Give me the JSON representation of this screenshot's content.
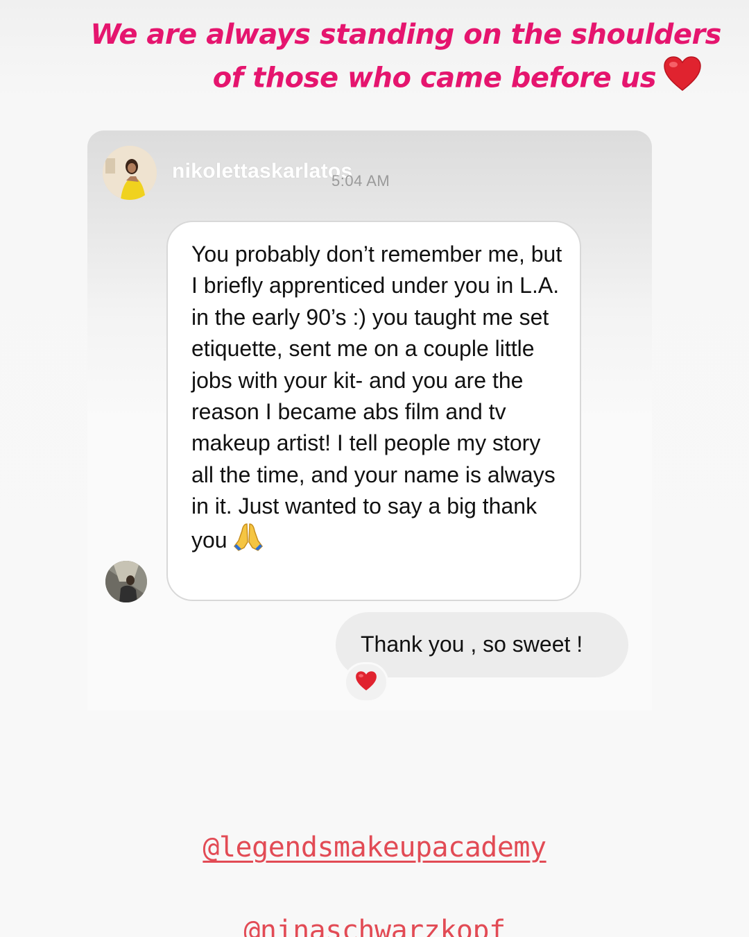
{
  "story": {
    "headline_line1": "We are always standing on the shoulders",
    "headline_line2": "of those who came before us",
    "headline_emoji": "heart-icon",
    "headline_color": "#e5156e"
  },
  "dm": {
    "username": "nikolettaskarlatos",
    "timestamp": "5:04 AM",
    "incoming_message": "You probably don’t remember me, but I briefly apprenticed under you in L.A. in the early 90’s :) you taught me set etiquette, sent me on a couple little jobs with your kit- and you are the reason I became abs film and tv makeup artist! I tell people my story all the time, and your name is always in it. Just wanted to say a big thank you",
    "incoming_emoji": "praying-hands-icon",
    "outgoing_message": "Thank you , so sweet !",
    "reaction_emoji": "heart-icon"
  },
  "mentions": {
    "primary": "@legendsmakeupacademy",
    "secondary_partial": "@ninaschwarzkopf"
  }
}
